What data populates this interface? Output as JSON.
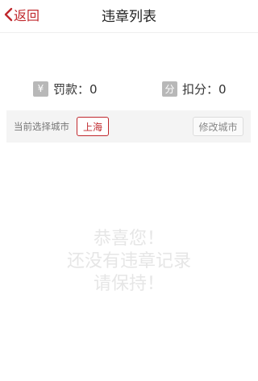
{
  "nav": {
    "back_label": "返回",
    "title": "违章列表"
  },
  "summary": {
    "fine_badge": "¥",
    "fine_text": "罚款：0",
    "points_badge": "分",
    "points_text": "扣分：0"
  },
  "city_bar": {
    "label": "当前选择城市",
    "current_city": "上海",
    "change_button": "修改城市"
  },
  "empty_state": {
    "line1": "恭喜您！",
    "line2": "还没有违章记录",
    "line3": "请保持！"
  },
  "colors": {
    "accent": "#c0282d",
    "badge": "#b8b8b8",
    "empty_text": "#e6e6e6"
  }
}
